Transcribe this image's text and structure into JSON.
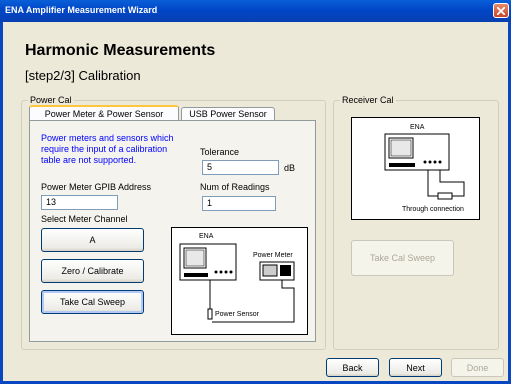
{
  "window": {
    "title": "ENA Amplifier Measurement Wizard"
  },
  "heading": "Harmonic Measurements",
  "step": "[step2/3] Calibration",
  "power_cal": {
    "legend": "Power Cal",
    "tabs": [
      {
        "label": "Power Meter & Power Sensor",
        "active": true
      },
      {
        "label": "USB Power Sensor",
        "active": false
      }
    ],
    "note_lines": [
      "Power meters and sensors which",
      "require the input of a calibration",
      "table are not supported."
    ],
    "tolerance": {
      "label": "Tolerance",
      "value": "5",
      "unit": "dB"
    },
    "gpib": {
      "label": "Power Meter GPIB Address",
      "value": "13"
    },
    "num_readings": {
      "label": "Num of Readings",
      "value": "1"
    },
    "channel": {
      "label": "Select Meter Channel",
      "button": "A"
    },
    "zero_button": "Zero / Calibrate",
    "sweep_button": "Take Cal Sweep",
    "diagram": {
      "ena_label": "ENA",
      "meter_label": "Power Meter",
      "sensor_label": "Power Sensor"
    }
  },
  "receiver_cal": {
    "legend": "Receiver Cal",
    "diagram": {
      "ena_label": "ENA",
      "connection_label": "Through connection"
    },
    "sweep_button": "Take Cal Sweep"
  },
  "footer": {
    "back": "Back",
    "next": "Next",
    "done": "Done"
  }
}
